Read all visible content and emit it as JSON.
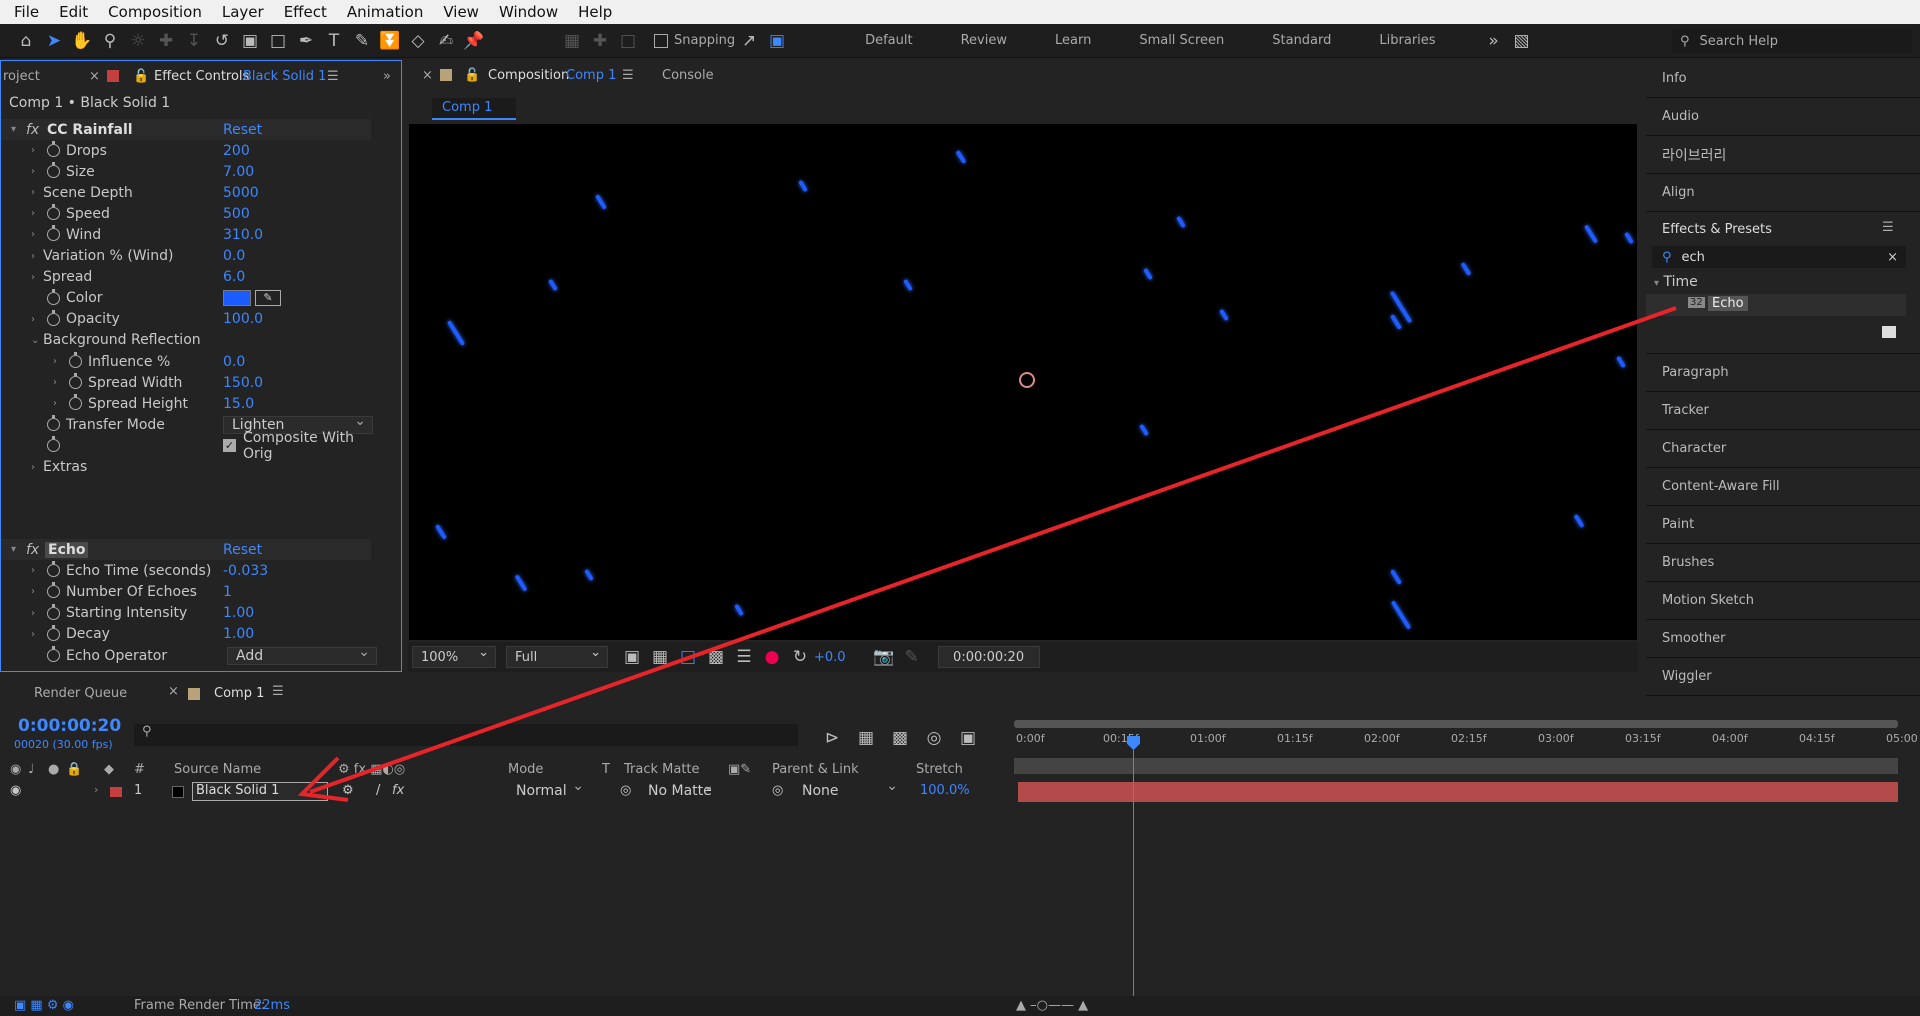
{
  "menubar": {
    "items": [
      "File",
      "Edit",
      "Composition",
      "Layer",
      "Effect",
      "Animation",
      "View",
      "Window",
      "Help"
    ]
  },
  "toolbar": {
    "snapping_label": "Snapping",
    "workspaces": [
      "Default",
      "Review",
      "Learn",
      "Small Screen",
      "Standard",
      "Libraries"
    ],
    "search_help_placeholder": "Search Help"
  },
  "left_panel": {
    "tab_project": "roject",
    "tab_effect_controls": "Effect Controls",
    "tab_effect_controls_layer": "Black Solid 1",
    "breadcrumb": "Comp 1 • Black Solid 1",
    "cc_rainfall": {
      "name": "CC Rainfall",
      "reset": "Reset",
      "params": [
        {
          "name": "Drops",
          "value": "200"
        },
        {
          "name": "Size",
          "value": "7.00"
        },
        {
          "name": "Scene Depth",
          "value": "5000"
        },
        {
          "name": "Speed",
          "value": "500"
        },
        {
          "name": "Wind",
          "value": "310.0"
        },
        {
          "name": "Variation % (Wind)",
          "value": "0.0"
        },
        {
          "name": "Spread",
          "value": "6.0"
        },
        {
          "name": "Color",
          "value": ""
        },
        {
          "name": "Opacity",
          "value": "100.0"
        },
        {
          "name": "Background Reflection",
          "value": ""
        },
        {
          "name": "Influence %",
          "value": "0.0"
        },
        {
          "name": "Spread Width",
          "value": "150.0"
        },
        {
          "name": "Spread Height",
          "value": "15.0"
        },
        {
          "name": "Transfer Mode",
          "value": "Lighten"
        },
        {
          "name": "",
          "value": "Composite With Orig"
        },
        {
          "name": "Extras",
          "value": ""
        }
      ],
      "color_swatch": "#1a5cff"
    },
    "echo": {
      "name": "Echo",
      "reset": "Reset",
      "params": [
        {
          "name": "Echo Time (seconds)",
          "value": "-0.033"
        },
        {
          "name": "Number Of Echoes",
          "value": "1"
        },
        {
          "name": "Starting Intensity",
          "value": "1.00"
        },
        {
          "name": "Decay",
          "value": "1.00"
        },
        {
          "name": "Echo Operator",
          "value": "Add"
        }
      ]
    }
  },
  "composition": {
    "tab_label": "Composition",
    "tab_comp": "Comp 1",
    "console_tab": "Console",
    "sub_tab": "Comp 1",
    "zoom": "100%",
    "resolution": "Full",
    "exposure": "+0.0",
    "timecode": "0:00:00:20"
  },
  "right_panel": {
    "items_top": [
      "Info",
      "Audio",
      "라이브러리",
      "Align"
    ],
    "effects_presets": "Effects & Presets",
    "search_value": "ech",
    "category": "Time",
    "result_badge": "32",
    "result": "Echo",
    "items_bottom": [
      "Paragraph",
      "Tracker",
      "Character",
      "Content-Aware Fill",
      "Paint",
      "Brushes",
      "Motion Sketch",
      "Smoother",
      "Wiggler"
    ]
  },
  "timeline": {
    "render_queue_tab": "Render Queue",
    "comp_tab": "Comp 1",
    "timecode": "0:00:00:20",
    "timecode_sub": "00020 (30.00 fps)",
    "columns": {
      "num": "#",
      "source": "Source Name",
      "mode": "Mode",
      "t": "T",
      "track_matte": "Track Matte",
      "parent": "Parent & Link",
      "stretch": "Stretch"
    },
    "layer": {
      "index": "1",
      "name": "Black Solid 1",
      "mode": "Normal",
      "track_matte": "No Matte",
      "parent": "None",
      "stretch": "100.0%"
    },
    "ruler": [
      "0:00f",
      "00:15f",
      "01:00f",
      "01:15f",
      "02:00f",
      "02:15f",
      "03:00f",
      "03:15f",
      "04:00f",
      "04:15f",
      "05:00"
    ]
  },
  "status": {
    "label": "Frame Render Time:",
    "value": "22ms"
  },
  "colors": {
    "accent": "#3d87ff",
    "layer_bar": "#b44b4b",
    "annotation_arrow": "#e8242b"
  }
}
